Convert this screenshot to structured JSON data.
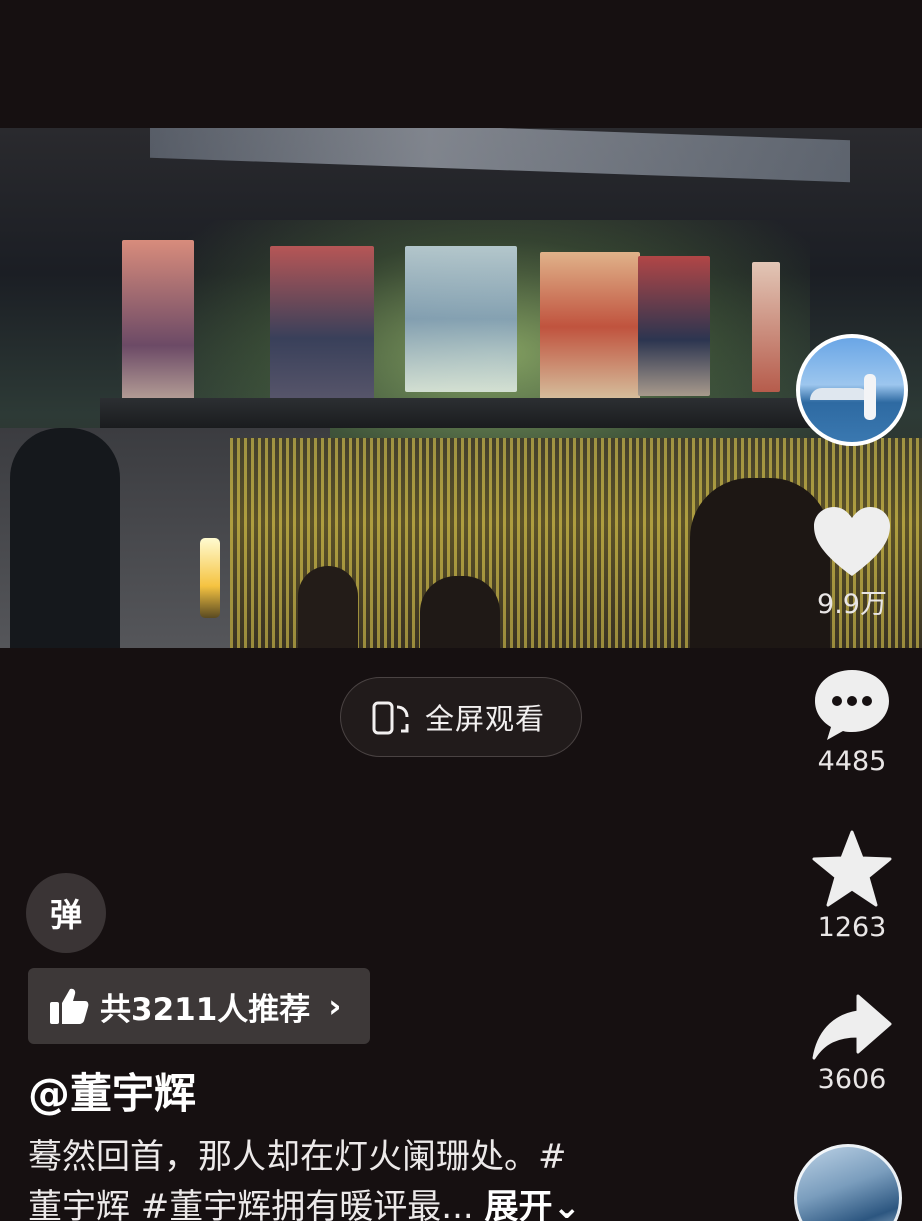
{
  "video": {
    "description_alt": ""
  },
  "author": {
    "name": "@董宇辉"
  },
  "actions": {
    "like_count": "9.9万",
    "comment_count": "4485",
    "favorite_count": "1263",
    "share_count": "3606"
  },
  "fullscreen": {
    "label": "全屏观看"
  },
  "danmu": {
    "label": "弹"
  },
  "recommend": {
    "label": "共3211人推荐"
  },
  "caption": {
    "line1": "蓦然回首，那人却在灯火阑珊处。#",
    "line2": "董宇辉 #董宇辉拥有暖评最...",
    "expand": "展开"
  },
  "colors": {
    "background": "#161011",
    "chip": "#3d3838",
    "icon": "#eeeeee"
  }
}
